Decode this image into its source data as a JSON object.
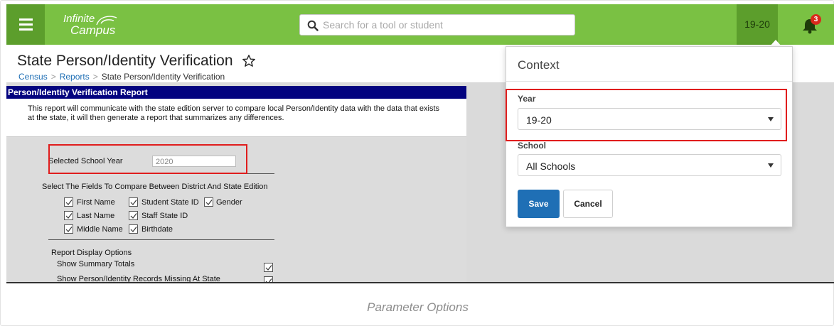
{
  "app": {
    "logo_line1": "Infinite",
    "logo_line2": "Campus",
    "search_placeholder": "Search for a tool or student",
    "year_button": "19-20",
    "notification_count": "3",
    "brand_color": "#7ac143"
  },
  "page": {
    "title": "State Person/Identity Verification",
    "breadcrumb": [
      "Census",
      "Reports",
      "State Person/Identity Verification"
    ]
  },
  "report": {
    "header": "Person/Identity Verification Report",
    "description": "This report will communicate with the state edition server to compare local Person/Identity data with the data that exists at the state, it will then generate a report that summarizes any differences.",
    "school_year_label": "Selected School Year",
    "school_year_value": "2020",
    "fields_heading": "Select The Fields To Compare Between District And State Edition",
    "fields": [
      {
        "label": "First Name",
        "checked": true
      },
      {
        "label": "Student State ID",
        "checked": true
      },
      {
        "label": "Gender",
        "checked": true
      },
      {
        "label": "Last Name",
        "checked": true
      },
      {
        "label": "Staff State ID",
        "checked": true
      },
      {
        "label": "Middle Name",
        "checked": true
      },
      {
        "label": "Birthdate",
        "checked": true
      }
    ],
    "display_options_heading": "Report Display Options",
    "display_options": [
      {
        "label": "Show Summary Totals",
        "checked": true
      },
      {
        "label": "Show Person/Identity Records Missing At State",
        "checked": true
      }
    ]
  },
  "context": {
    "title": "Context",
    "year_label": "Year",
    "year_value": "19-20",
    "school_label": "School",
    "school_value": "All Schools",
    "save_label": "Save",
    "cancel_label": "Cancel"
  },
  "caption": "Parameter Options"
}
